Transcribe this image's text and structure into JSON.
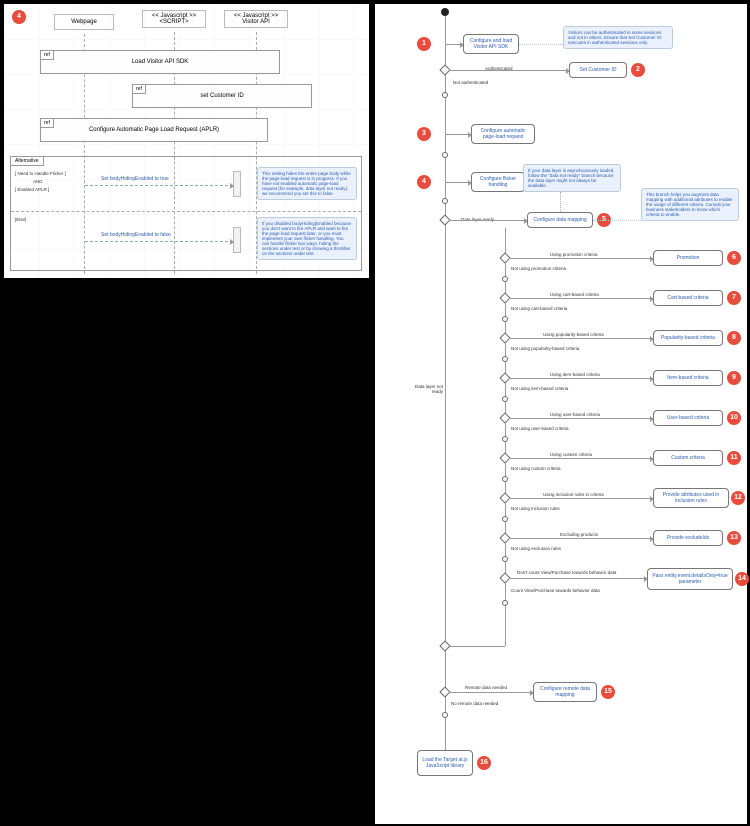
{
  "left_panel": {
    "badge": "4",
    "columns": {
      "webpage": "Webpage",
      "script": "<< Javascript >>\n<SCRIPT>",
      "visitor_api": "<< Javascript >>\nVisitor API"
    },
    "refs": {
      "load_sdk": "Load Visitor API SDK",
      "set_customer_id": "set Customer ID",
      "configure_aplr": "Configure Automatic Page Load Request (APLR)"
    },
    "alternative": {
      "tab": "Alternative",
      "cond1": "[ Need to Handle Flicker ]",
      "cond2": "AND",
      "cond3": "[ Enabled APLR ]",
      "else": "[Else]",
      "set_true": "Set bodyHidingEnabled to true",
      "set_false": "Set bodyHidingEnabled to false"
    },
    "notes": {
      "n1": "This setting hides the entire page body while the page-load request is in progress. If you have not enabled automatic page-load request (for example, data layer not ready), we recommend you set this to false.",
      "n2": "If you disabled bodyHiding(Enabled because you don't want to fire APLR and want to fire the page-load request later, or you must implement your own flicker handling. You can handle flicker two ways: hiding the sections under test or by showing a throbber on the sections under test."
    }
  },
  "flow": {
    "n1": {
      "label": "Configure and load Visitor API SDK",
      "note": "Visitors can be authenticated in some sessions and not in others. Ensure that Set Customer ID executes in authenticated sessions only."
    },
    "authenticated": "Authenticated",
    "not_auth": "Not authenticated",
    "n2": {
      "label": "Set Customer ID"
    },
    "n3": {
      "label": "Configure automatic page-load request"
    },
    "n4": {
      "label": "Configure flicker handling"
    },
    "data_ready": "Data layer ready",
    "data_not_ready": "Data layer not ready",
    "n5": {
      "label": "Configure data mapping",
      "note_left": "If your data layer is asynchronously loaded, follow the \"data not ready\" branch because the data layer might not always be available.",
      "note_right": "This branch helps you augment data mapping with additional attributes to enable the usage of different criteria. Consult your business stakeholders to know which criteria to enable."
    },
    "n6": {
      "label": "Promotion",
      "edge_yes": "Using promotion criteria",
      "edge_no": "Not using promotion criteria"
    },
    "n7": {
      "label": "Cart-based criteria",
      "edge_yes": "Using cart-based criteria",
      "edge_no": "Not using cart-based criteria"
    },
    "n8": {
      "label": "Popularity-based criteria",
      "edge_yes": "Using popularity-based criteria",
      "edge_no": "Not using popularity-based criteria"
    },
    "n9": {
      "label": "Item-based criteria",
      "edge_yes": "Using item-based criteria",
      "edge_no": "Not using item-based criteria"
    },
    "n10": {
      "label": "User-based criteria",
      "edge_yes": "Using user-based criteria",
      "edge_no": "Not using user-based criteria"
    },
    "n11": {
      "label": "Custom criteria",
      "edge_yes": "Using custom criteria",
      "edge_no": "Not using custom criteria"
    },
    "n12": {
      "label": "Provide attributes used in inclusion rules",
      "edge_yes": "Using inclusion rules in criteria",
      "edge_no": "Not using inclusion rules"
    },
    "n13": {
      "label": "Provide excludeIds",
      "edge_yes": "Excluding products",
      "edge_no": "Not using exclusion rules"
    },
    "n14": {
      "label": "Pass entity.event.detailsOnly=true parameter",
      "edge_yes": "Don't count View/Purchase towards behavior data",
      "edge_no": "Count View/Purchase towards behavior data"
    },
    "n15": {
      "label": "Configure remote data mapping",
      "edge_yes": "Remote data needed",
      "edge_no": "No remote data needed"
    },
    "n16": {
      "label": "Load the Target at.js JavaScript library"
    }
  },
  "colors": {
    "badge_bg": "#e74c3c",
    "link_color": "#2b5db2",
    "note_bg": "#eaf1fc"
  }
}
